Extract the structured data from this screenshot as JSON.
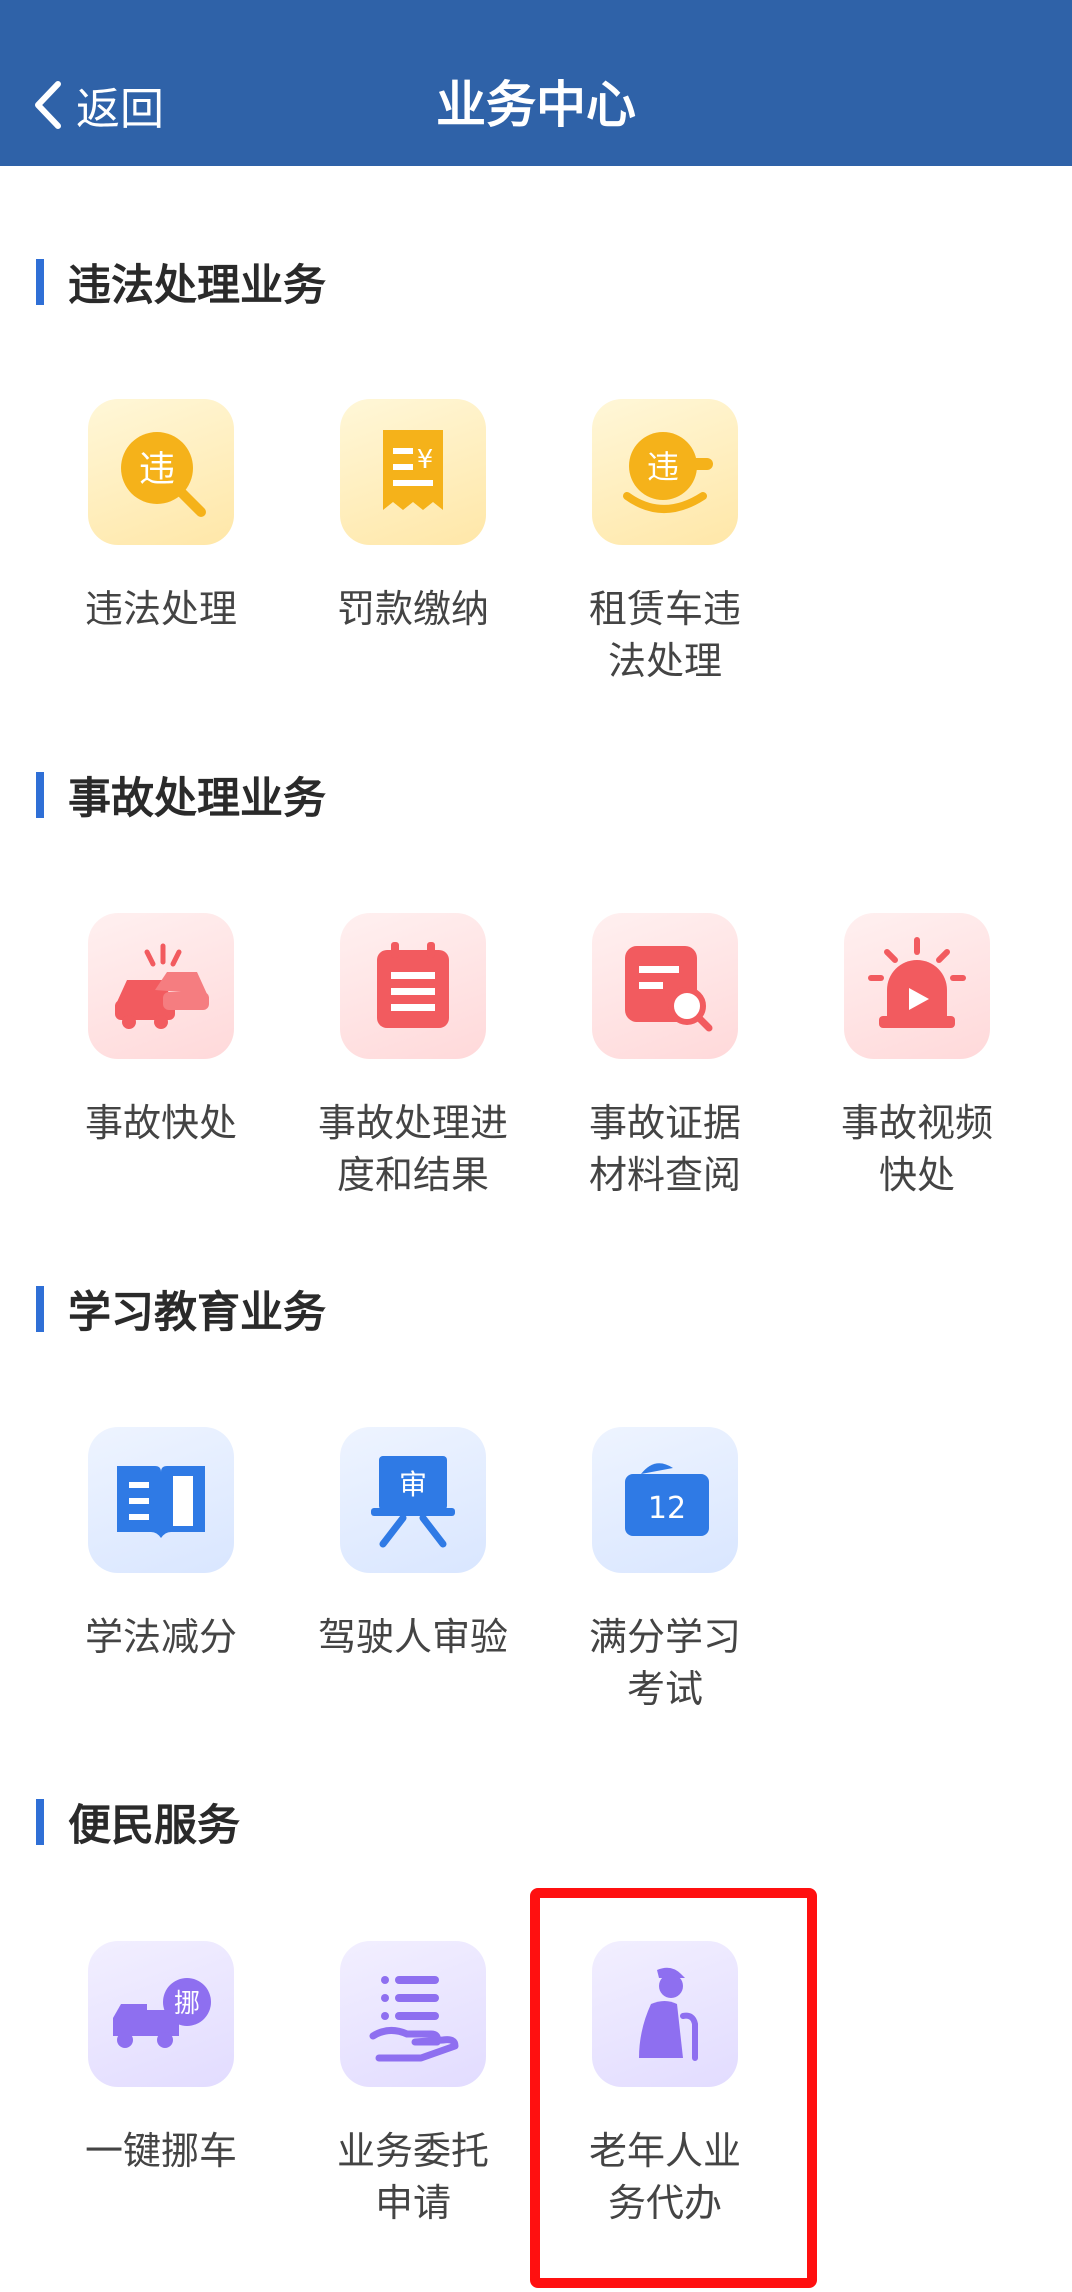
{
  "header": {
    "back_label": "返回",
    "title": "业务中心"
  },
  "sections": [
    {
      "title": "违法处理业务",
      "items": [
        {
          "label": "违法处理",
          "icon": "violation-search-icon"
        },
        {
          "label": "罚款缴纳",
          "icon": "fine-receipt-icon"
        },
        {
          "label": "租赁车违\n法处理",
          "icon": "rental-violation-icon"
        }
      ]
    },
    {
      "title": "事故处理业务",
      "items": [
        {
          "label": "事故快处",
          "icon": "car-crash-icon"
        },
        {
          "label": "事故处理进\n度和结果",
          "icon": "progress-calendar-icon"
        },
        {
          "label": "事故证据\n材料查阅",
          "icon": "document-search-icon"
        },
        {
          "label": "事故视频\n快处",
          "icon": "alarm-video-icon"
        }
      ]
    },
    {
      "title": "学习教育业务",
      "items": [
        {
          "label": "学法减分",
          "icon": "open-book-icon"
        },
        {
          "label": "驾驶人审验",
          "icon": "review-board-icon"
        },
        {
          "label": "满分学习\n考试",
          "icon": "calendar-12-icon"
        }
      ]
    },
    {
      "title": "便民服务",
      "items": [
        {
          "label": "一键挪车",
          "icon": "move-car-icon"
        },
        {
          "label": "业务委托\n申请",
          "icon": "entrust-hand-icon"
        },
        {
          "label": "老年人业\n务代办",
          "icon": "elderly-person-icon"
        }
      ]
    }
  ],
  "icon_badge_texts": {
    "violation": "违",
    "move_car": "挪",
    "review": "审",
    "calendar_day": "12"
  },
  "colors": {
    "header_bg": "#2f62a8",
    "section_bar": "#2f6fd6",
    "yellow_icon": "#f5b21a",
    "red_icon": "#f25b5f",
    "blue_icon": "#2f7ae5",
    "purple_icon": "#8e6ff0",
    "highlight_border": "#ff1010"
  }
}
